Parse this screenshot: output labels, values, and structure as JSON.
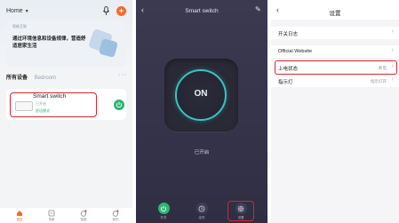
{
  "home": {
    "title": "Home",
    "banner_small": "智能互联",
    "banner_text": "通过环境信息和设备规律，营造舒适居家生活",
    "rooms": [
      "所有设备",
      "Bedroom"
    ],
    "more": "···",
    "device": {
      "name": "Smart switch",
      "line1": "已开启",
      "line2": "舒适模式"
    },
    "tabs": [
      "首页",
      "场景",
      "智能",
      "我的"
    ]
  },
  "switch": {
    "title": "Smart switch",
    "button_text": "ON",
    "status": "已开启",
    "controls": [
      "开关",
      "定时",
      "设置"
    ]
  },
  "settings": {
    "title": "设置",
    "rows": [
      {
        "label": "开关日志",
        "value": ""
      },
      {
        "label": "Official Website",
        "value": ""
      },
      {
        "label": "上电状态",
        "value": "断电"
      },
      {
        "label": "指示灯",
        "value": "指示灯开"
      }
    ]
  },
  "colors": {
    "accent_orange": "#f36a2b",
    "switch_on_green": "#2bb673",
    "ring_teal": "#35c6c0",
    "highlight_red": "#d6262f"
  }
}
